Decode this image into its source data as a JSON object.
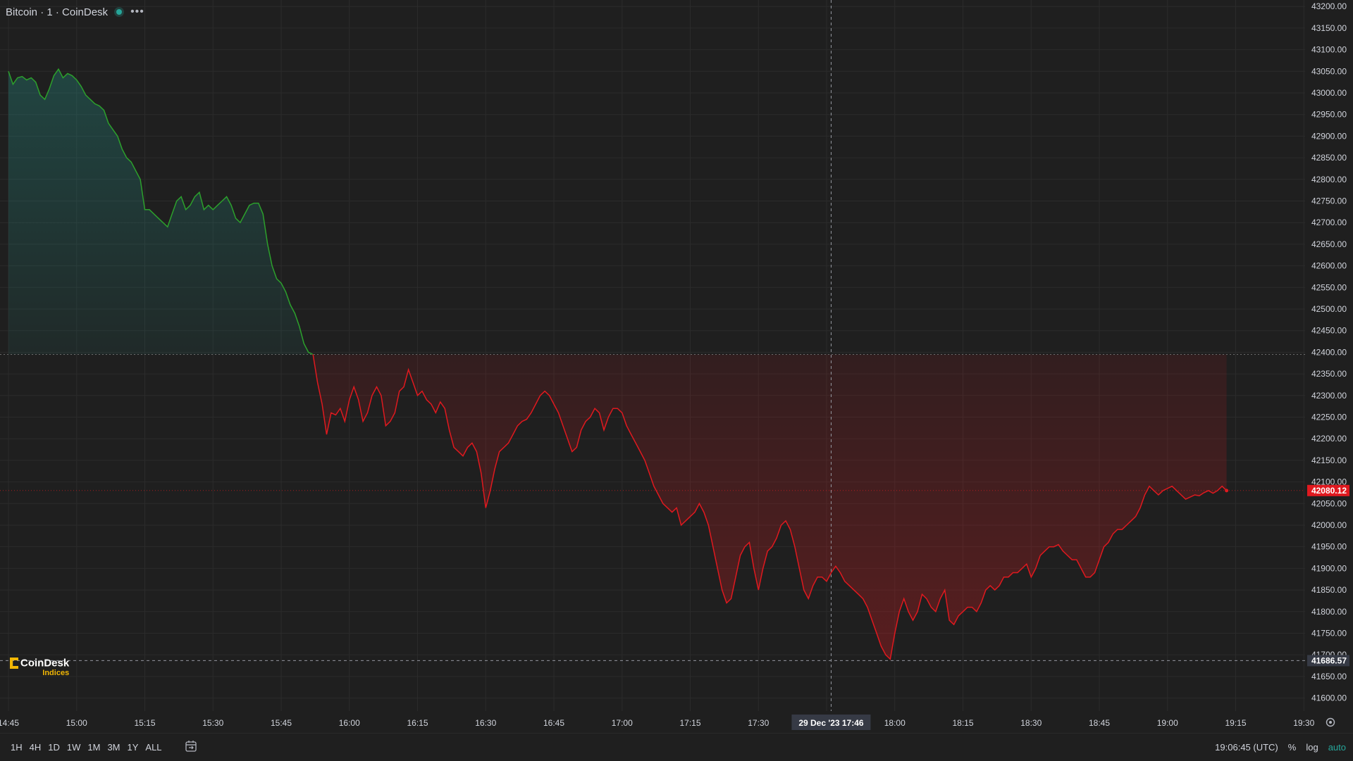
{
  "header": {
    "title": "Bitcoin · 1 · CoinDesk",
    "more_icon": "ellipsis-icon",
    "status_color": "#26a69a"
  },
  "logo": {
    "name": "CoinDesk",
    "sub": "Indices",
    "color": "#f2b705"
  },
  "bottom_bar": {
    "ranges": [
      "1H",
      "4H",
      "1D",
      "1W",
      "1M",
      "3M",
      "1Y",
      "ALL"
    ],
    "calendar_icon": "calendar-icon",
    "clock": "19:06:45 (UTC)",
    "tools": {
      "percent": "%",
      "log": "log",
      "auto": "auto"
    }
  },
  "chart_data": {
    "type": "line",
    "colors": {
      "up": "#26a69a",
      "up_line": "#2ca02c",
      "down": "#e0191f",
      "grid": "#2b2b2b",
      "axis_text": "#d1d4dc"
    },
    "ylim": [
      41570,
      43215
    ],
    "y_ticks": [
      41600,
      41650,
      41700,
      41750,
      41800,
      41850,
      41900,
      41950,
      42000,
      42050,
      42100,
      42150,
      42200,
      42250,
      42300,
      42350,
      42400,
      42450,
      42500,
      42550,
      42600,
      42650,
      42700,
      42750,
      42800,
      42850,
      42900,
      42950,
      43000,
      43050,
      43100,
      43150,
      43200
    ],
    "x_ticks": [
      "14:45",
      "15:00",
      "15:15",
      "15:30",
      "15:45",
      "16:00",
      "16:15",
      "16:30",
      "16:45",
      "17:00",
      "17:15",
      "17:30",
      "17:45",
      "18:00",
      "18:15",
      "18:30",
      "18:45",
      "19:00",
      "19:15",
      "19:30"
    ],
    "baseline": 42395,
    "last_price": "42080.12",
    "last_price_value": 42080.12,
    "crosshair": {
      "time": "17:46",
      "label": "29 Dec '23  17:46",
      "price": "41686.57",
      "price_value": 41686.57
    },
    "series_minute_offset_start": 0,
    "values": [
      43050,
      43020,
      43035,
      43038,
      43030,
      43035,
      43025,
      42995,
      42985,
      43010,
      43040,
      43055,
      43035,
      43045,
      43040,
      43030,
      43015,
      42995,
      42985,
      42975,
      42970,
      42960,
      42930,
      42915,
      42900,
      42870,
      42850,
      42840,
      42820,
      42800,
      42730,
      42730,
      42720,
      42710,
      42700,
      42690,
      42720,
      42750,
      42760,
      42730,
      42740,
      42760,
      42770,
      42730,
      42740,
      42730,
      42740,
      42750,
      42760,
      42740,
      42710,
      42700,
      42720,
      42740,
      42745,
      42745,
      42720,
      42650,
      42600,
      42570,
      42560,
      42540,
      42510,
      42490,
      42460,
      42420,
      42400,
      42395,
      42330,
      42280,
      42210,
      42260,
      42255,
      42270,
      42240,
      42290,
      42320,
      42290,
      42240,
      42260,
      42300,
      42320,
      42300,
      42230,
      42240,
      42260,
      42310,
      42320,
      42360,
      42330,
      42300,
      42310,
      42290,
      42280,
      42260,
      42285,
      42270,
      42220,
      42180,
      42170,
      42160,
      42180,
      42190,
      42170,
      42120,
      42040,
      42080,
      42130,
      42170,
      42180,
      42190,
      42210,
      42230,
      42240,
      42245,
      42260,
      42280,
      42300,
      42310,
      42300,
      42280,
      42260,
      42230,
      42200,
      42170,
      42180,
      42220,
      42240,
      42250,
      42270,
      42260,
      42220,
      42250,
      42270,
      42270,
      42260,
      42230,
      42210,
      42190,
      42170,
      42150,
      42120,
      42090,
      42070,
      42050,
      42040,
      42030,
      42040,
      42000,
      42010,
      42020,
      42030,
      42050,
      42030,
      42000,
      41950,
      41900,
      41850,
      41820,
      41830,
      41880,
      41930,
      41950,
      41960,
      41900,
      41850,
      41900,
      41940,
      41950,
      41970,
      42000,
      42010,
      41990,
      41950,
      41900,
      41850,
      41830,
      41860,
      41880,
      41880,
      41870,
      41890,
      41905,
      41890,
      41870,
      41860,
      41850,
      41840,
      41830,
      41810,
      41780,
      41750,
      41720,
      41700,
      41690,
      41750,
      41800,
      41830,
      41800,
      41780,
      41800,
      41840,
      41830,
      41810,
      41800,
      41830,
      41850,
      41780,
      41770,
      41790,
      41800,
      41810,
      41810,
      41800,
      41820,
      41850,
      41860,
      41850,
      41860,
      41880,
      41880,
      41890,
      41890,
      41900,
      41910,
      41880,
      41900,
      41930,
      41940,
      41950,
      41950,
      41955,
      41940,
      41930,
      41920,
      41920,
      41900,
      41880,
      41880,
      41890,
      41920,
      41950,
      41960,
      41980,
      41990,
      41990,
      42000,
      42010,
      42020,
      42040,
      42070,
      42090,
      42080,
      42070,
      42080,
      42085,
      42090,
      42080,
      42070,
      42060,
      42065,
      42070,
      42068,
      42075,
      42080,
      42074,
      42080,
      42090,
      42080
    ]
  }
}
